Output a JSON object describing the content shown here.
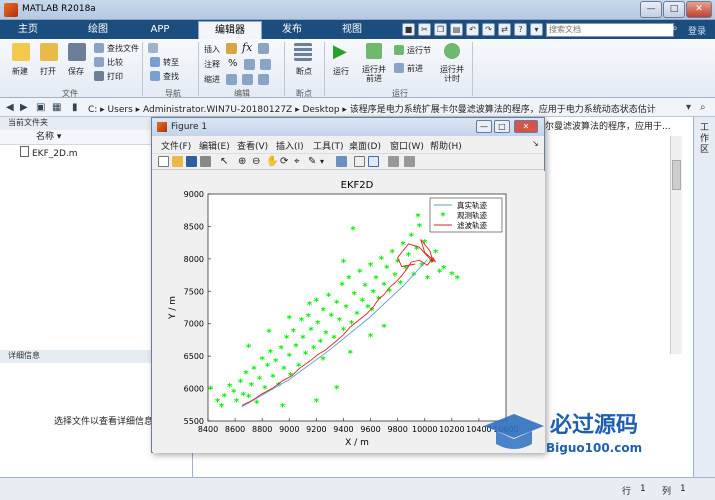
{
  "window": {
    "title": "MATLAB R2018a"
  },
  "tabs": [
    {
      "label": "主页",
      "active": false
    },
    {
      "label": "绘图",
      "active": false
    },
    {
      "label": "APP",
      "active": false
    },
    {
      "label": "编辑器",
      "active": true
    },
    {
      "label": "发布",
      "active": false
    },
    {
      "label": "视图",
      "active": false
    }
  ],
  "search": {
    "placeholder": "搜索文档"
  },
  "login": "登录",
  "ribbon": {
    "file": {
      "new": "新建",
      "open": "打开",
      "save": "保存",
      "find_files": "查找文件",
      "compare": "比较",
      "print": "打印",
      "group": "文件"
    },
    "navigate": {
      "goto": "转至",
      "find": "查找",
      "group": "导航"
    },
    "edit": {
      "insert": "插入",
      "comment": "注释",
      "indent": "缩进",
      "group": "编辑"
    },
    "breakpoints": {
      "breakpoint": "断点",
      "group": "断点"
    },
    "run": {
      "run": "运行",
      "run_advance": "运行并\n前进",
      "run_section": "运行节",
      "advance": "前进",
      "run_time": "运行并\n计时",
      "group": "运行"
    }
  },
  "address": {
    "path": "C: ▸ Users ▸ Administrator.WIN7U-2018012​7Z ▸ Desktop ▸ 该程序是电力系统扩展卡尔曼滤波算法的程序，应用于电力系统动态状态估计"
  },
  "left_panel": {
    "title": "当前文件夹",
    "column": "名称",
    "files": [
      "EKF_2D.m"
    ],
    "details_title": "详细信息",
    "details_text": "选择文件以查看详细信息"
  },
  "editor_tab_text": "尔曼滤波算法的程序，应用于...",
  "workspace_label": "工作区",
  "status": {
    "row_label": "行",
    "row": "1",
    "col_label": "列",
    "col": "1"
  },
  "figure": {
    "title": "Figure 1",
    "menu": [
      "文件(F)",
      "编辑(E)",
      "查看(V)",
      "插入(I)",
      "工具(T)",
      "桌面(D)",
      "窗口(W)",
      "帮助(H)"
    ]
  },
  "watermark": {
    "brand": "必过源码",
    "url": "Biguo100.com"
  },
  "chart_data": {
    "type": "scatter",
    "title": "EKF2D",
    "xlabel": "X / m",
    "ylabel": "Y / m",
    "xlim": [
      8400,
      10600
    ],
    "ylim": [
      5500,
      9000
    ],
    "xticks": [
      8400,
      8600,
      8800,
      9000,
      9200,
      9400,
      9600,
      9800,
      10000,
      10200,
      10400,
      10600
    ],
    "yticks": [
      5500,
      6000,
      6500,
      7000,
      7500,
      8000,
      8500,
      9000
    ],
    "legend_position": "top-right",
    "series": [
      {
        "name": "真实轨迹",
        "kind": "line",
        "color": "#5b9bd5",
        "points": [
          [
            8650,
            5720
          ],
          [
            9000,
            6140
          ],
          [
            9300,
            6600
          ],
          [
            9600,
            7110
          ],
          [
            9850,
            7600
          ],
          [
            10020,
            7990
          ]
        ]
      },
      {
        "name": "观测轨迹",
        "kind": "marker",
        "color": "#00ee00",
        "points": [
          [
            8420,
            5990
          ],
          [
            8470,
            5800
          ],
          [
            8500,
            5720
          ],
          [
            8520,
            5880
          ],
          [
            8560,
            6030
          ],
          [
            8590,
            5950
          ],
          [
            8610,
            5800
          ],
          [
            8640,
            6100
          ],
          [
            8660,
            5900
          ],
          [
            8680,
            6230
          ],
          [
            8700,
            5870
          ],
          [
            8720,
            6050
          ],
          [
            8740,
            6300
          ],
          [
            8760,
            5780
          ],
          [
            8780,
            6150
          ],
          [
            8800,
            6450
          ],
          [
            8820,
            6000
          ],
          [
            8840,
            6350
          ],
          [
            8860,
            6560
          ],
          [
            8880,
            6180
          ],
          [
            8900,
            6420
          ],
          [
            8920,
            6050
          ],
          [
            8940,
            6620
          ],
          [
            8960,
            6300
          ],
          [
            8980,
            6780
          ],
          [
            9000,
            6500
          ],
          [
            9010,
            6200
          ],
          [
            9030,
            6880
          ],
          [
            9050,
            6650
          ],
          [
            9070,
            6350
          ],
          [
            9090,
            7050
          ],
          [
            9100,
            6780
          ],
          [
            9120,
            6530
          ],
          [
            9140,
            7110
          ],
          [
            9160,
            6900
          ],
          [
            9180,
            6620
          ],
          [
            9200,
            7350
          ],
          [
            9210,
            7000
          ],
          [
            9230,
            6720
          ],
          [
            9250,
            7200
          ],
          [
            9270,
            6850
          ],
          [
            9290,
            7430
          ],
          [
            9310,
            7120
          ],
          [
            9330,
            6780
          ],
          [
            9350,
            7320
          ],
          [
            9370,
            7050
          ],
          [
            9390,
            7600
          ],
          [
            9400,
            6900
          ],
          [
            9420,
            7250
          ],
          [
            9440,
            7700
          ],
          [
            9460,
            7000
          ],
          [
            9480,
            7450
          ],
          [
            9500,
            7150
          ],
          [
            9520,
            7800
          ],
          [
            9540,
            7350
          ],
          [
            9560,
            7580
          ],
          [
            9580,
            7250
          ],
          [
            9600,
            7900
          ],
          [
            9620,
            7480
          ],
          [
            9640,
            7700
          ],
          [
            9660,
            7380
          ],
          [
            9680,
            8000
          ],
          [
            9700,
            7600
          ],
          [
            9720,
            7860
          ],
          [
            9740,
            7500
          ],
          [
            9760,
            8100
          ],
          [
            9780,
            7740
          ],
          [
            9800,
            7950
          ],
          [
            9820,
            7620
          ],
          [
            9840,
            8220
          ],
          [
            9860,
            7850
          ],
          [
            9880,
            8050
          ],
          [
            9900,
            8350
          ],
          [
            9920,
            7750
          ],
          [
            9940,
            8150
          ],
          [
            9960,
            8500
          ],
          [
            9980,
            7900
          ],
          [
            10000,
            8250
          ],
          [
            10020,
            7700
          ],
          [
            10050,
            7950
          ],
          [
            10080,
            8100
          ],
          [
            10110,
            7800
          ],
          [
            10140,
            7850
          ],
          [
            10200,
            7760
          ],
          [
            10240,
            7700
          ],
          [
            9950,
            8650
          ],
          [
            9470,
            8450
          ],
          [
            9610,
            7200
          ],
          [
            9250,
            6450
          ],
          [
            9000,
            7080
          ],
          [
            8850,
            6870
          ],
          [
            9150,
            7300
          ],
          [
            9350,
            6000
          ],
          [
            9400,
            7950
          ],
          [
            9450,
            6550
          ],
          [
            8950,
            5720
          ],
          [
            9200,
            5800
          ],
          [
            9600,
            6800
          ],
          [
            9700,
            6950
          ],
          [
            8700,
            6640
          ]
        ]
      },
      {
        "name": "滤波轨迹",
        "kind": "line",
        "color": "#e02020",
        "points": [
          [
            8650,
            5740
          ],
          [
            8720,
            5810
          ],
          [
            8800,
            5920
          ],
          [
            8880,
            6010
          ],
          [
            8950,
            6120
          ],
          [
            9020,
            6200
          ],
          [
            9080,
            6320
          ],
          [
            9150,
            6420
          ],
          [
            9210,
            6520
          ],
          [
            9270,
            6600
          ],
          [
            9340,
            6720
          ],
          [
            9400,
            6830
          ],
          [
            9450,
            6950
          ],
          [
            9510,
            7050
          ],
          [
            9570,
            7150
          ],
          [
            9620,
            7260
          ],
          [
            9660,
            7380
          ],
          [
            9700,
            7450
          ],
          [
            9740,
            7560
          ],
          [
            9790,
            7650
          ],
          [
            9830,
            7740
          ],
          [
            9870,
            7850
          ],
          [
            9900,
            7950
          ],
          [
            9960,
            7980
          ],
          [
            10020,
            7900
          ],
          [
            10060,
            8020
          ],
          [
            10080,
            7950
          ],
          [
            10000,
            8100
          ],
          [
            9970,
            8300
          ],
          [
            10040,
            8120
          ],
          [
            10060,
            7950
          ],
          [
            9960,
            8180
          ],
          [
            9880,
            8230
          ],
          [
            9800,
            8020
          ],
          [
            9830,
            7880
          ],
          [
            9930,
            7920
          ]
        ]
      }
    ]
  }
}
